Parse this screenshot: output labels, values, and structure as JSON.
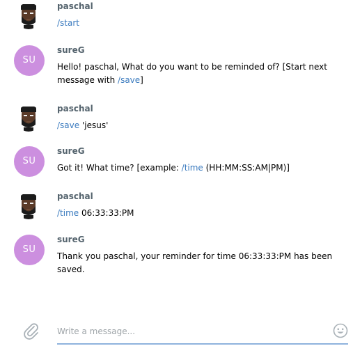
{
  "messages": [
    {
      "sender": "paschal",
      "avatar": "bearded-man-avatar",
      "parts": [
        {
          "t": "/start",
          "cmd": true
        }
      ]
    },
    {
      "sender": "sureG",
      "avatar_initials": "SU",
      "avatar_color": "#cc8fdf",
      "parts": [
        {
          "t": "Hello! paschal, What do you want to be reminded of? [Start next message with ",
          "cmd": false
        },
        {
          "t": "/save",
          "cmd": true
        },
        {
          "t": "]",
          "cmd": false
        }
      ]
    },
    {
      "sender": "paschal",
      "avatar": "bearded-man-avatar",
      "parts": [
        {
          "t": "/save",
          "cmd": true
        },
        {
          "t": " 'jesus'",
          "cmd": false
        }
      ]
    },
    {
      "sender": "sureG",
      "avatar_initials": "SU",
      "avatar_color": "#cc8fdf",
      "parts": [
        {
          "t": "Got it! What time? [example: ",
          "cmd": false
        },
        {
          "t": "/time",
          "cmd": true
        },
        {
          "t": " (HH:MM:SS:AM|PM)]",
          "cmd": false
        }
      ]
    },
    {
      "sender": "paschal",
      "avatar": "bearded-man-avatar",
      "parts": [
        {
          "t": "/time",
          "cmd": true
        },
        {
          "t": " 06:33:33:PM",
          "cmd": false
        }
      ]
    },
    {
      "sender": "sureG",
      "avatar_initials": "SU",
      "avatar_color": "#cc8fdf",
      "parts": [
        {
          "t": "Thank you paschal, your reminder for time 06:33:33:PM has been saved.",
          "cmd": false
        }
      ]
    }
  ],
  "composer": {
    "placeholder": "Write a message...",
    "value": "",
    "attach_icon": "paperclip-icon",
    "emoji_icon": "smiley-icon"
  },
  "colors": {
    "command_link": "#3b7bbf",
    "sender_name": "#55646e",
    "input_underline": "#8fb3dd"
  }
}
